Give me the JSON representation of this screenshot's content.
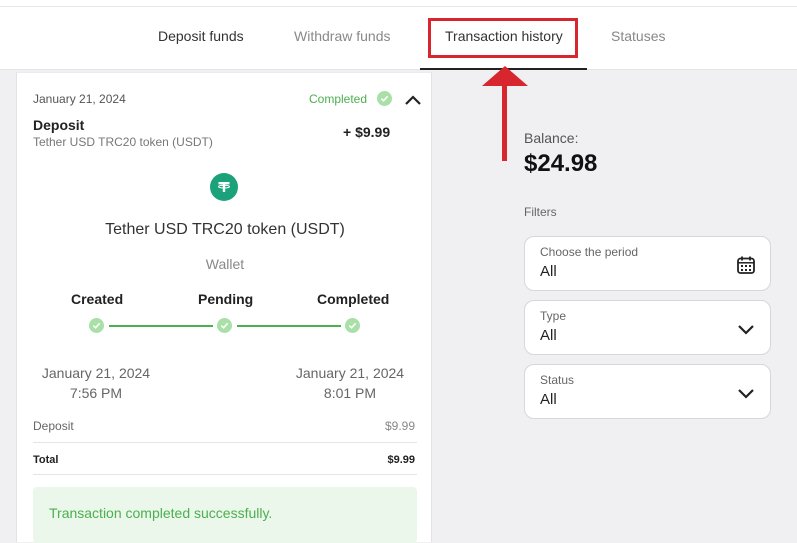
{
  "tabs": [
    {
      "label": "Deposit funds"
    },
    {
      "label": "Withdraw funds"
    },
    {
      "label": "Transaction history"
    },
    {
      "label": "Statuses"
    }
  ],
  "active_tab": "Transaction history",
  "colors": {
    "highlight": "#d7262e",
    "success": "#4caf50",
    "tether": "#1ba27a"
  },
  "transaction": {
    "date": "January 21, 2024",
    "status": "Completed",
    "type": "Deposit",
    "method": "Tether USD TRC20 token (USDT)",
    "amount": "+ $9.99",
    "token_name": "Tether USD TRC20 token (USDT)",
    "wallet_label": "Wallet",
    "steps": [
      {
        "label": "Created"
      },
      {
        "label": "Pending"
      },
      {
        "label": "Completed"
      }
    ],
    "created_date": "January 21, 2024",
    "created_time": "7:56 PM",
    "completed_date": "January 21, 2024",
    "completed_time": "8:01 PM",
    "lines": [
      {
        "label": "Deposit",
        "value": "$9.99"
      },
      {
        "label": "Total",
        "value": "$9.99"
      }
    ],
    "success_message": "Transaction completed successfully."
  },
  "balance": {
    "label": "Balance:",
    "value": "$24.98"
  },
  "filters": {
    "label": "Filters",
    "period": {
      "label": "Choose the period",
      "value": "All",
      "icon": "calendar-icon"
    },
    "type": {
      "label": "Type",
      "value": "All",
      "icon": "chevron-down-icon"
    },
    "status": {
      "label": "Status",
      "value": "All",
      "icon": "chevron-down-icon"
    }
  }
}
